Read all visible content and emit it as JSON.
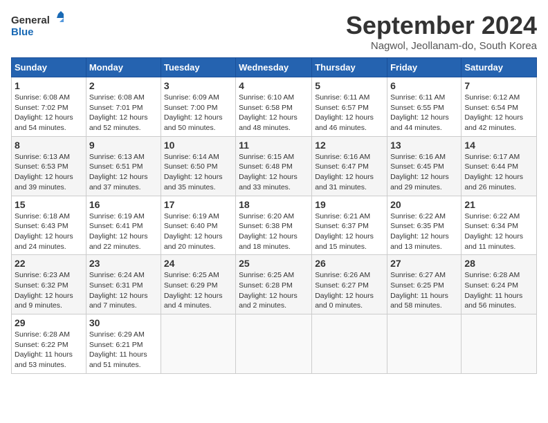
{
  "header": {
    "logo_line1": "General",
    "logo_line2": "Blue",
    "month_title": "September 2024",
    "subtitle": "Nagwol, Jeollanam-do, South Korea"
  },
  "weekdays": [
    "Sunday",
    "Monday",
    "Tuesday",
    "Wednesday",
    "Thursday",
    "Friday",
    "Saturday"
  ],
  "weeks": [
    [
      {
        "day": "1",
        "sunrise": "6:08 AM",
        "sunset": "7:02 PM",
        "daylight": "12 hours and 54 minutes."
      },
      {
        "day": "2",
        "sunrise": "6:08 AM",
        "sunset": "7:01 PM",
        "daylight": "12 hours and 52 minutes."
      },
      {
        "day": "3",
        "sunrise": "6:09 AM",
        "sunset": "7:00 PM",
        "daylight": "12 hours and 50 minutes."
      },
      {
        "day": "4",
        "sunrise": "6:10 AM",
        "sunset": "6:58 PM",
        "daylight": "12 hours and 48 minutes."
      },
      {
        "day": "5",
        "sunrise": "6:11 AM",
        "sunset": "6:57 PM",
        "daylight": "12 hours and 46 minutes."
      },
      {
        "day": "6",
        "sunrise": "6:11 AM",
        "sunset": "6:55 PM",
        "daylight": "12 hours and 44 minutes."
      },
      {
        "day": "7",
        "sunrise": "6:12 AM",
        "sunset": "6:54 PM",
        "daylight": "12 hours and 42 minutes."
      }
    ],
    [
      {
        "day": "8",
        "sunrise": "6:13 AM",
        "sunset": "6:53 PM",
        "daylight": "12 hours and 39 minutes."
      },
      {
        "day": "9",
        "sunrise": "6:13 AM",
        "sunset": "6:51 PM",
        "daylight": "12 hours and 37 minutes."
      },
      {
        "day": "10",
        "sunrise": "6:14 AM",
        "sunset": "6:50 PM",
        "daylight": "12 hours and 35 minutes."
      },
      {
        "day": "11",
        "sunrise": "6:15 AM",
        "sunset": "6:48 PM",
        "daylight": "12 hours and 33 minutes."
      },
      {
        "day": "12",
        "sunrise": "6:16 AM",
        "sunset": "6:47 PM",
        "daylight": "12 hours and 31 minutes."
      },
      {
        "day": "13",
        "sunrise": "6:16 AM",
        "sunset": "6:45 PM",
        "daylight": "12 hours and 29 minutes."
      },
      {
        "day": "14",
        "sunrise": "6:17 AM",
        "sunset": "6:44 PM",
        "daylight": "12 hours and 26 minutes."
      }
    ],
    [
      {
        "day": "15",
        "sunrise": "6:18 AM",
        "sunset": "6:43 PM",
        "daylight": "12 hours and 24 minutes."
      },
      {
        "day": "16",
        "sunrise": "6:19 AM",
        "sunset": "6:41 PM",
        "daylight": "12 hours and 22 minutes."
      },
      {
        "day": "17",
        "sunrise": "6:19 AM",
        "sunset": "6:40 PM",
        "daylight": "12 hours and 20 minutes."
      },
      {
        "day": "18",
        "sunrise": "6:20 AM",
        "sunset": "6:38 PM",
        "daylight": "12 hours and 18 minutes."
      },
      {
        "day": "19",
        "sunrise": "6:21 AM",
        "sunset": "6:37 PM",
        "daylight": "12 hours and 15 minutes."
      },
      {
        "day": "20",
        "sunrise": "6:22 AM",
        "sunset": "6:35 PM",
        "daylight": "12 hours and 13 minutes."
      },
      {
        "day": "21",
        "sunrise": "6:22 AM",
        "sunset": "6:34 PM",
        "daylight": "12 hours and 11 minutes."
      }
    ],
    [
      {
        "day": "22",
        "sunrise": "6:23 AM",
        "sunset": "6:32 PM",
        "daylight": "12 hours and 9 minutes."
      },
      {
        "day": "23",
        "sunrise": "6:24 AM",
        "sunset": "6:31 PM",
        "daylight": "12 hours and 7 minutes."
      },
      {
        "day": "24",
        "sunrise": "6:25 AM",
        "sunset": "6:29 PM",
        "daylight": "12 hours and 4 minutes."
      },
      {
        "day": "25",
        "sunrise": "6:25 AM",
        "sunset": "6:28 PM",
        "daylight": "12 hours and 2 minutes."
      },
      {
        "day": "26",
        "sunrise": "6:26 AM",
        "sunset": "6:27 PM",
        "daylight": "12 hours and 0 minutes."
      },
      {
        "day": "27",
        "sunrise": "6:27 AM",
        "sunset": "6:25 PM",
        "daylight": "11 hours and 58 minutes."
      },
      {
        "day": "28",
        "sunrise": "6:28 AM",
        "sunset": "6:24 PM",
        "daylight": "11 hours and 56 minutes."
      }
    ],
    [
      {
        "day": "29",
        "sunrise": "6:28 AM",
        "sunset": "6:22 PM",
        "daylight": "11 hours and 53 minutes."
      },
      {
        "day": "30",
        "sunrise": "6:29 AM",
        "sunset": "6:21 PM",
        "daylight": "11 hours and 51 minutes."
      },
      null,
      null,
      null,
      null,
      null
    ]
  ]
}
